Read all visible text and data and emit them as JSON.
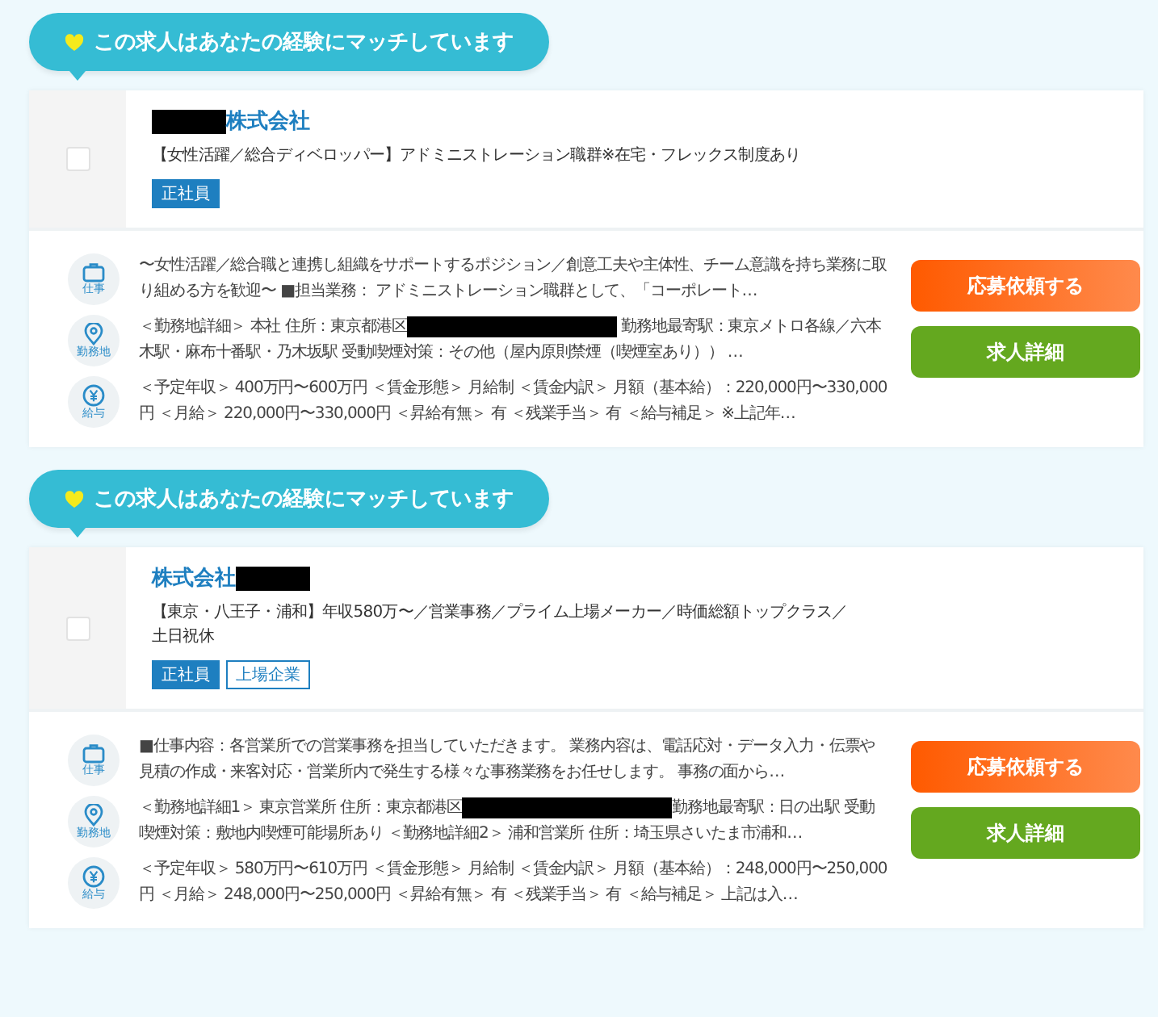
{
  "jobs": [
    {
      "match_badge": "この求人はあなたの経験にマッチしています",
      "checked": false,
      "company": [
        {
          "kind": "redaction"
        },
        {
          "kind": "text",
          "text": "株式会社"
        }
      ],
      "title": "【女性活躍／総合ディベロッパー】アドミニストレーション職群※在宅・フレックス制度あり",
      "tags": [
        {
          "label": "正社員",
          "kind": "filled"
        }
      ],
      "details": [
        {
          "kind": "work",
          "label": "仕事",
          "parts": [
            {
              "kind": "text",
              "text": "〜女性活躍／総合職と連携し組織をサポートするポジション／創意工夫や主体性、チーム意識を持ち業務に取り組める方を歓迎〜 ■担当業務： アドミニストレーション職群として、「コーポレート…"
            }
          ]
        },
        {
          "kind": "location",
          "label": "勤務地",
          "parts": [
            {
              "kind": "text",
              "text": "＜勤務地詳細＞ 本社 住所：東京都港区"
            },
            {
              "kind": "redaction"
            },
            {
              "kind": "text",
              "text": " 勤務地最寄駅：東京メトロ各線／六本木駅・麻布十番駅・乃木坂駅 受動喫煙対策：その他（屋内原則禁煙（喫煙室あり）） …"
            }
          ]
        },
        {
          "kind": "salary",
          "label": "給与",
          "parts": [
            {
              "kind": "text",
              "text": "＜予定年収＞ 400万円〜600万円 ＜賃金形態＞ 月給制 ＜賃金内訳＞ 月額（基本給）：220,000円〜330,000円 ＜月給＞ 220,000円〜330,000円 ＜昇給有無＞ 有 ＜残業手当＞ 有 ＜給与補足＞ ※上記年…"
            }
          ]
        }
      ],
      "buttons": [
        {
          "label": "応募依頼する",
          "kind": "apply"
        },
        {
          "label": "求人詳細",
          "kind": "detail"
        }
      ]
    },
    {
      "match_badge": "この求人はあなたの経験にマッチしています",
      "checked": false,
      "company": [
        {
          "kind": "text",
          "text": "株式会社"
        },
        {
          "kind": "redaction"
        }
      ],
      "title": "【東京・八王子・浦和】年収580万〜／営業事務／プライム上場メーカー／時価総額トップクラス／土日祝休",
      "tags": [
        {
          "label": "正社員",
          "kind": "filled"
        },
        {
          "label": "上場企業",
          "kind": "outline"
        }
      ],
      "details": [
        {
          "kind": "work",
          "label": "仕事",
          "parts": [
            {
              "kind": "text",
              "text": "■仕事内容：各営業所での営業事務を担当していただきます。 業務内容は、電話応対・データ入力・伝票や見積の作成・来客対応・営業所内で発生する様々な事務業務をお任せします。 事務の面から…"
            }
          ]
        },
        {
          "kind": "location",
          "label": "勤務地",
          "parts": [
            {
              "kind": "text",
              "text": "＜勤務地詳細1＞ 東京営業所 住所：東京都港区"
            },
            {
              "kind": "redaction"
            },
            {
              "kind": "text",
              "text": "勤務地最寄駅：日の出駅 受動喫煙対策：敷地内喫煙可能場所あり ＜勤務地詳細2＞ 浦和営業所 住所：埼玉県さいたま市浦和…"
            }
          ]
        },
        {
          "kind": "salary",
          "label": "給与",
          "parts": [
            {
              "kind": "text",
              "text": "＜予定年収＞ 580万円〜610万円 ＜賃金形態＞ 月給制 ＜賃金内訳＞ 月額（基本給）：248,000円〜250,000円 ＜月給＞ 248,000円〜250,000円 ＜昇給有無＞ 有 ＜残業手当＞ 有 ＜給与補足＞ 上記は入…"
            }
          ]
        }
      ],
      "buttons": [
        {
          "label": "応募依頼する",
          "kind": "apply"
        },
        {
          "label": "求人詳細",
          "kind": "detail"
        }
      ]
    }
  ]
}
